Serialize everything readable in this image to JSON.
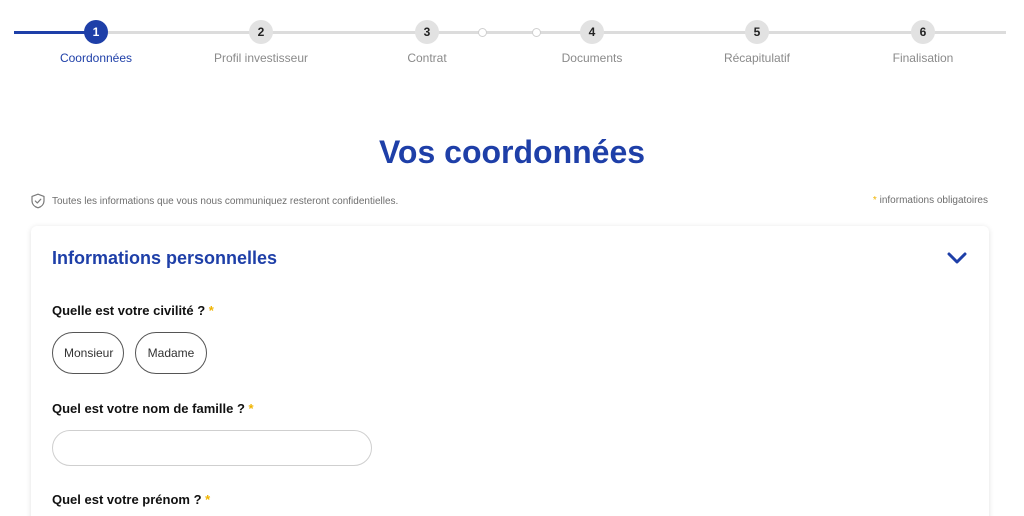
{
  "stepper": {
    "steps": [
      {
        "number": "1",
        "label": "Coordonnées"
      },
      {
        "number": "2",
        "label": "Profil investisseur"
      },
      {
        "number": "3",
        "label": "Contrat"
      },
      {
        "number": "4",
        "label": "Documents"
      },
      {
        "number": "5",
        "label": "Récapitulatif"
      },
      {
        "number": "6",
        "label": "Finalisation"
      }
    ],
    "active_step": "1"
  },
  "page_title": "Vos coordonnées",
  "notice": {
    "icon": "shield-check-icon",
    "text": "Toutes les informations que vous nous communiquez resteront confidentielles."
  },
  "required_note": {
    "star": "*",
    "text": "informations obligatoires"
  },
  "section": {
    "title": "Informations personnelles",
    "toggle_icon": "chevron-down-icon",
    "questions": {
      "civility": {
        "label": "Quelle est votre civilité ?",
        "star": "*",
        "options": [
          "Monsieur",
          "Madame"
        ]
      },
      "last_name": {
        "label": "Quel est votre nom de famille ?",
        "star": "*",
        "value": ""
      },
      "first_name": {
        "label": "Quel est votre prénom ?",
        "star": "*"
      }
    }
  },
  "colors": {
    "brand_blue": "#1e3fa8",
    "required_star": "#f0b400",
    "inactive_step": "#e2e2e2"
  }
}
